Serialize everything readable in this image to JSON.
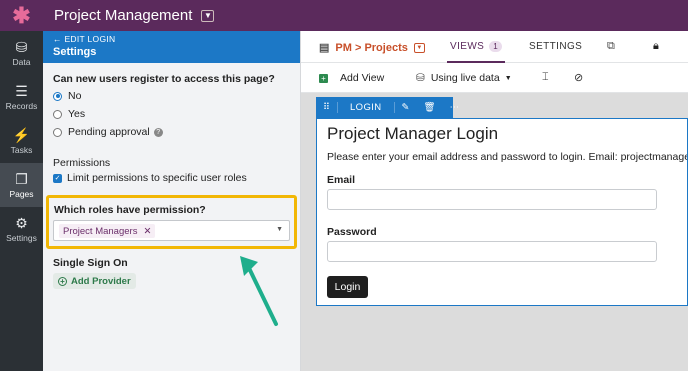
{
  "app": {
    "logo_icon": "asterisk-logo-icon",
    "title": "Project Management",
    "accent_color": "#5b2a5c"
  },
  "nav": [
    {
      "label": "Data",
      "icon": "data-icon",
      "glyph": "⛁"
    },
    {
      "label": "Records",
      "icon": "records-icon",
      "glyph": "☰"
    },
    {
      "label": "Tasks",
      "icon": "tasks-icon",
      "glyph": "⚡"
    },
    {
      "label": "Pages",
      "icon": "pages-icon",
      "glyph": "❐"
    },
    {
      "label": "Settings",
      "icon": "settings-icon",
      "glyph": "⚙"
    }
  ],
  "nav_active": "Pages",
  "panel": {
    "back_label": "← EDIT LOGIN",
    "title": "Settings",
    "question": "Can new users register to access this page?",
    "options": [
      "No",
      "Yes",
      "Pending approval"
    ],
    "selected_option": "No",
    "permissions_label": "Permissions",
    "limit_label": "Limit permissions to specific user roles",
    "limit_checked": true,
    "roles_label": "Which roles have permission?",
    "roles_selected": [
      "Project Managers"
    ],
    "sso_label": "Single Sign On",
    "add_provider_label": "Add Provider"
  },
  "tabs": {
    "page_label": "PM > Projects",
    "views_label": "VIEWS",
    "views_count": "1",
    "settings_label": "SETTINGS"
  },
  "toolbar": {
    "add_view_label": "Add View",
    "data_mode_label": "Using live data"
  },
  "view": {
    "name": "LOGIN",
    "title": "Project Manager Login",
    "description": "Please enter your email address and password to login. Email: projectmanager@te",
    "email_label": "Email",
    "password_label": "Password",
    "login_button": "Login"
  }
}
